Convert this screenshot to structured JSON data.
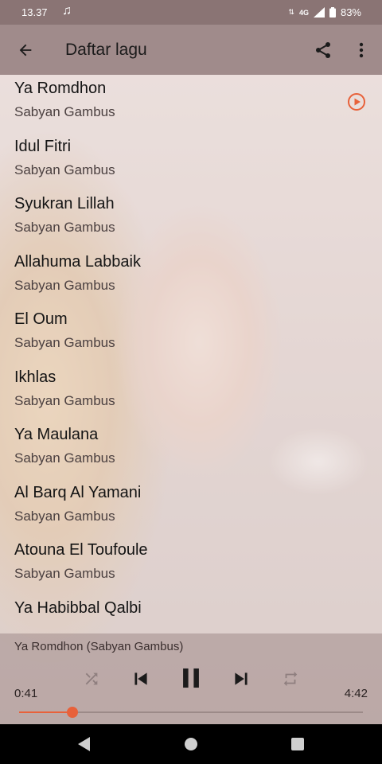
{
  "status_bar": {
    "time": "13.37",
    "network": "4G",
    "battery": "83%",
    "icons": [
      "music-note-icon",
      "data-arrows-icon",
      "signal-icon",
      "battery-icon"
    ]
  },
  "app_bar": {
    "title": "Daftar lagu",
    "icons": [
      "back-arrow-icon",
      "share-icon",
      "more-vert-icon"
    ]
  },
  "songs": [
    {
      "title": "Ya Romdhon",
      "artist": "Sabyan Gambus",
      "playing": true
    },
    {
      "title": "Idul Fitri",
      "artist": "Sabyan Gambus"
    },
    {
      "title": "Syukran Lillah",
      "artist": "Sabyan Gambus"
    },
    {
      "title": "Allahuma Labbaik",
      "artist": "Sabyan Gambus"
    },
    {
      "title": "El Oum",
      "artist": "Sabyan Gambus"
    },
    {
      "title": "Ikhlas",
      "artist": "Sabyan Gambus"
    },
    {
      "title": "Ya Maulana",
      "artist": "Sabyan Gambus"
    },
    {
      "title": "Al Barq Al Yamani",
      "artist": "Sabyan Gambus"
    },
    {
      "title": "Atouna El Toufoule",
      "artist": "Sabyan Gambus"
    },
    {
      "title": "Ya Habibbal Qalbi",
      "artist": ""
    }
  ],
  "player": {
    "now_playing": "Ya Romdhon (Sabyan Gambus)",
    "elapsed": "0:41",
    "total": "4:42",
    "progress": 0.155,
    "controls": [
      "shuffle-icon",
      "skip-previous-icon",
      "pause-icon",
      "skip-next-icon",
      "repeat-icon"
    ]
  },
  "colors": {
    "accent": "#e8613a",
    "app_bar": "#a08b8b",
    "status_bar": "#8a7474"
  },
  "nav_bar": {
    "icons": [
      "back-triangle-icon",
      "home-circle-icon",
      "recents-square-icon"
    ]
  }
}
